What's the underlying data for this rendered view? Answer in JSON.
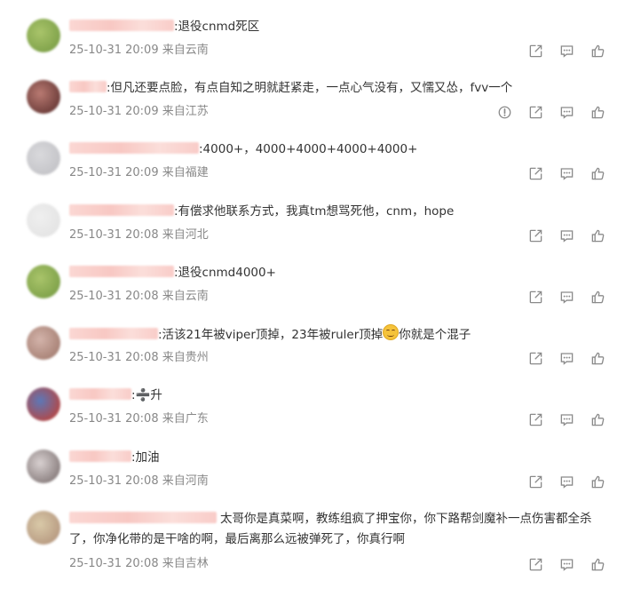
{
  "comments": [
    {
      "text": ":退役cnmd死区",
      "time": "25-10-31 20:09",
      "location": "来自云南",
      "report": false,
      "name_width": 118,
      "avatar": [
        "#a9c46a",
        "#7fa24a"
      ]
    },
    {
      "text": ":但凡还要点脸，有点自知之明就赶紧走，一点心气没有，又懦又怂，fvv一个",
      "time": "25-10-31 20:09",
      "location": "来自江苏",
      "report": true,
      "name_width": 42,
      "avatar": [
        "#b97a72",
        "#6d3d3a"
      ]
    },
    {
      "text": ":4000+，4000+4000+4000+4000+",
      "time": "25-10-31 20:09",
      "location": "来自福建",
      "report": false,
      "name_width": 146,
      "avatar": [
        "#d9d9dc",
        "#c4c4c8"
      ]
    },
    {
      "text": ":有偿求他联系方式，我真tm想骂死他，cnm，hope",
      "time": "25-10-31 20:08",
      "location": "来自河北",
      "report": false,
      "name_width": 118,
      "avatar": [
        "#efefef",
        "#e4e4e4"
      ]
    },
    {
      "text": ":退役cnmd4000+",
      "time": "25-10-31 20:08",
      "location": "来自云南",
      "report": false,
      "name_width": 118,
      "avatar": [
        "#a9c46a",
        "#7fa24a"
      ]
    },
    {
      "text_before": ":活该21年被viper顶掉，23年被ruler顶掉",
      "emoji": "smile-emoji",
      "text_after": "你就是个混子",
      "time": "25-10-31 20:08",
      "location": "来自贵州",
      "report": false,
      "name_width": 100,
      "avatar": [
        "#d3b3aa",
        "#a88276"
      ]
    },
    {
      "text": ":➗升",
      "time": "25-10-31 20:08",
      "location": "来自广东",
      "report": false,
      "name_width": 70,
      "avatar": [
        "#5c78b8",
        "#b24848"
      ]
    },
    {
      "text": ":加油",
      "time": "25-10-31 20:08",
      "location": "来自河南",
      "report": false,
      "name_width": 70,
      "avatar": [
        "#d8d0d0",
        "#8b8080"
      ]
    },
    {
      "text": "太哥你是真菜啊，教练组疯了押宝你，你下路帮剑魔补一点伤害都全杀了，你净化带的是干啥的啊，最后离那么远被弹死了，你真行啊",
      "time": "25-10-31 20:08",
      "location": "来自吉林",
      "report": false,
      "name_width": 166,
      "wrap": true,
      "avatar": [
        "#d9c9a8",
        "#b89b82"
      ]
    }
  ],
  "icons": {
    "share": "share-icon",
    "comment": "comment-icon",
    "like": "like-icon",
    "report": "report-icon"
  }
}
